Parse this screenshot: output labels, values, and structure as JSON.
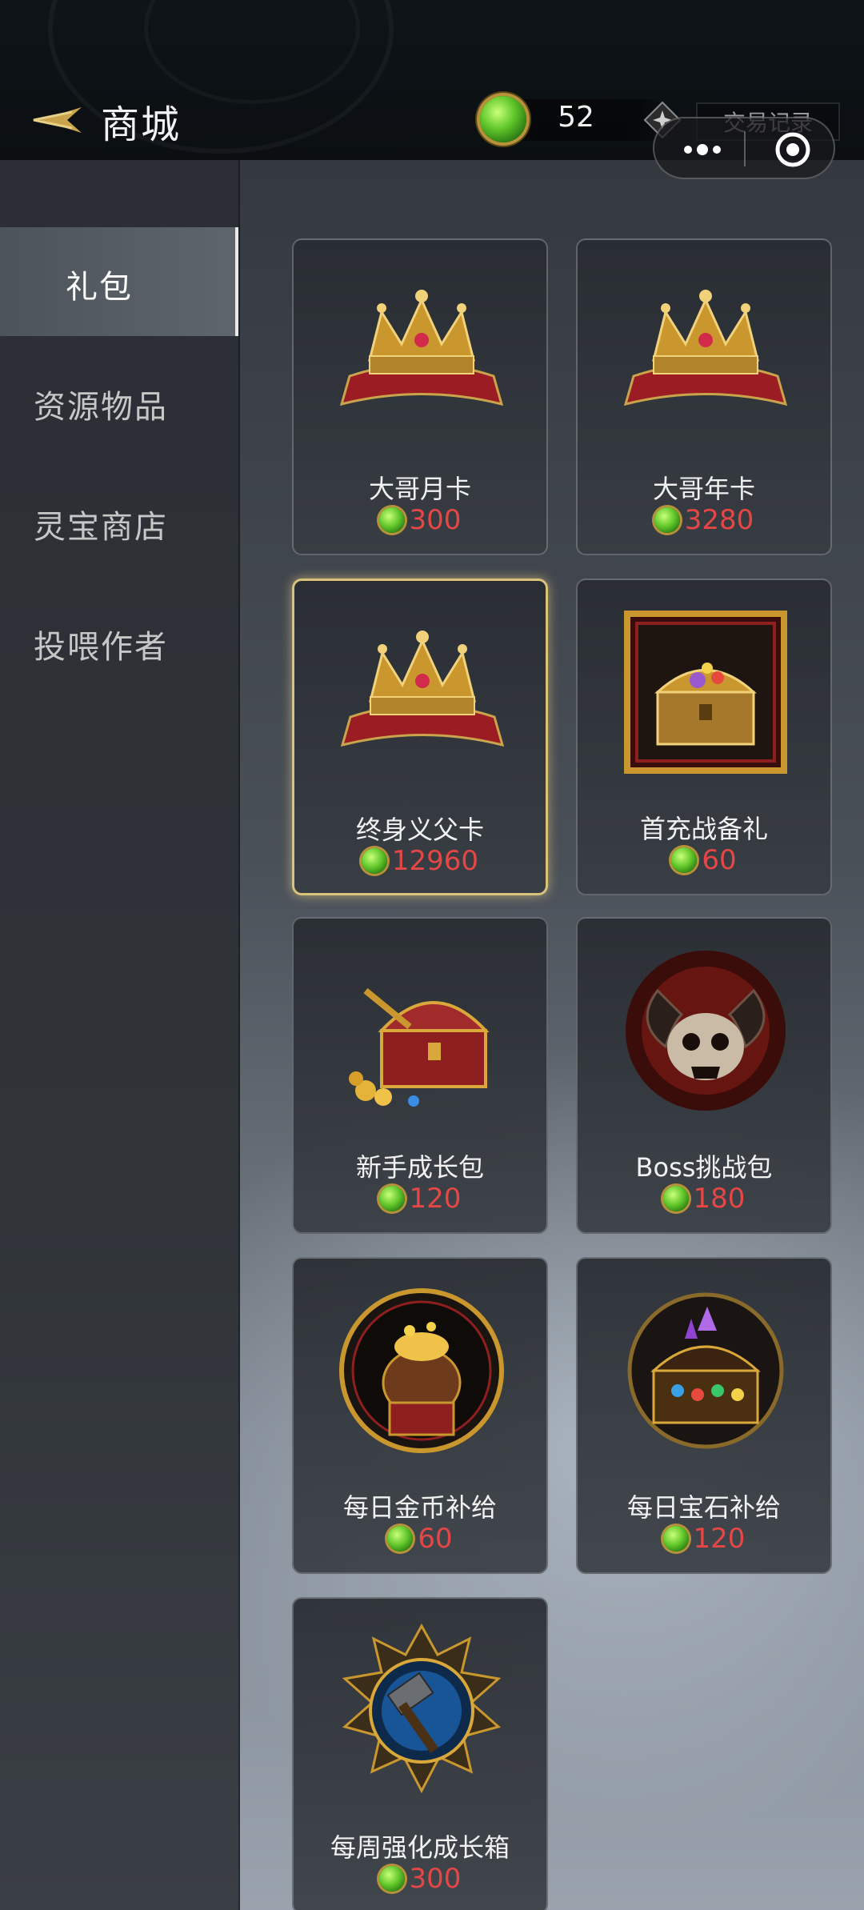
{
  "header": {
    "title": "商城",
    "currency_value": "52",
    "trade_label": "交易记录"
  },
  "sidebar": {
    "items": [
      {
        "label": "礼包",
        "active": true
      },
      {
        "label": "资源物品",
        "active": false
      },
      {
        "label": "灵宝商店",
        "active": false
      },
      {
        "label": "投喂作者",
        "active": false
      }
    ]
  },
  "products": [
    {
      "name": "大哥月卡",
      "price": "300",
      "icon": "crown-icon"
    },
    {
      "name": "大哥年卡",
      "price": "3280",
      "icon": "crown-icon"
    },
    {
      "name": "终身义父卡",
      "price": "12960",
      "icon": "crown-icon",
      "selected": true
    },
    {
      "name": "首充战备礼",
      "price": "60",
      "icon": "treasure-chest-icon"
    },
    {
      "name": "新手成长包",
      "price": "120",
      "icon": "treasure-chest-icon"
    },
    {
      "name": "Boss挑战包",
      "price": "180",
      "icon": "demon-skull-icon"
    },
    {
      "name": "每日金币补给",
      "price": "60",
      "icon": "gold-bag-icon"
    },
    {
      "name": "每日宝石补给",
      "price": "120",
      "icon": "gem-chest-icon"
    },
    {
      "name": "每周强化成长箱",
      "price": "300",
      "icon": "hammer-emblem-icon"
    }
  ],
  "colors": {
    "price": "#e54646",
    "selected_border": "#d9c37a",
    "currency_gem": "#62c82b"
  }
}
